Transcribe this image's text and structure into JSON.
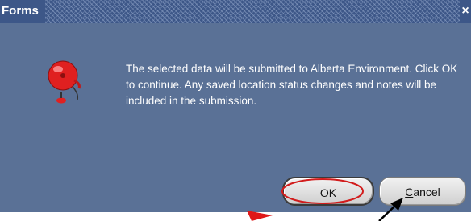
{
  "window": {
    "title": "Forms",
    "close_glyph": "×"
  },
  "dialog": {
    "icon": "alarm-bell-icon",
    "message": "The selected data will be submitted to Alberta Environment. Click OK to continue. Any saved location status changes and notes will be included in the submission."
  },
  "buttons": {
    "ok_label": "OK",
    "cancel_first": "C",
    "cancel_rest": "ancel"
  },
  "colors": {
    "dialog_bg": "#5a7196",
    "titlebar_bg": "#3d5788",
    "annotation_circle": "#d21c1c",
    "annotation_red_arrow": "#e01818",
    "annotation_black_arrow": "#000000"
  }
}
